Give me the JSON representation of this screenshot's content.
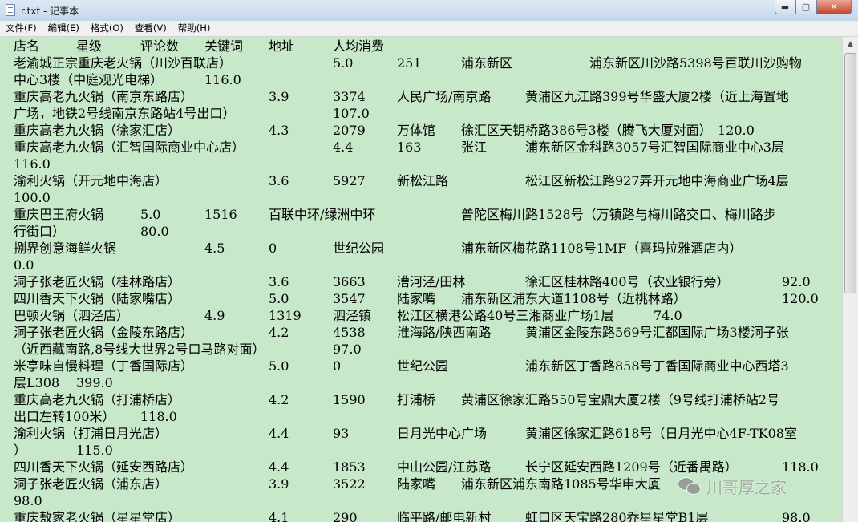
{
  "window": {
    "title": "r.txt - 记事本",
    "minimize": "▬",
    "maximize": "▢",
    "close": "✕"
  },
  "menu": [
    "文件(F)",
    "编辑(E)",
    "格式(O)",
    "查看(V)",
    "帮助(H)"
  ],
  "document": {
    "lines": [
      [
        "店名",
        "星级",
        "评论数",
        "关键词",
        "地址",
        "人均消费"
      ],
      [
        "老渝城正宗重庆老火锅（川沙百联店）",
        "5.0",
        "251",
        "浦东新区",
        "浦东新区川沙路5398号百联川沙购物"
      ],
      [
        "中心3楼（中庭观光电梯）",
        "116.0"
      ],
      [
        "重庆高老九火锅（南京东路店）",
        "3.9",
        "3374",
        "人民广场/南京路",
        "黄浦区九江路399号华盛大厦2楼（近上海置地"
      ],
      [
        "广场，地铁2号线南京东路站4号出口）",
        "107.0"
      ],
      [
        "重庆高老九火锅（徐家汇店）",
        "4.3",
        "2079",
        "万体馆",
        "徐汇区天钥桥路386号3楼（腾飞大厦对面）",
        "120.0"
      ],
      [
        "重庆高老九火锅（汇智国际商业中心店）",
        "4.4",
        "163",
        "张江",
        "浦东新区金科路3057号汇智国际商业中心3层"
      ],
      [
        "116.0"
      ],
      [
        "渝利火锅（开元地中海店）",
        "3.6",
        "5927",
        "新松江路",
        "松江区新松江路927弄开元地中海商业广场4层"
      ],
      [
        "100.0"
      ],
      [
        "重庆巴王府火锅",
        "5.0",
        "1516",
        "百联中环/绿洲中环",
        "普陀区梅川路1528号（万镇路与梅川路交口、梅川路步"
      ],
      [
        "行街口）",
        "80.0"
      ],
      [
        "捌界创意海鲜火锅",
        "4.5",
        "0",
        "世纪公园",
        "浦东新区梅花路1108号1MF（喜玛拉雅酒店内）"
      ],
      [
        "0.0"
      ],
      [
        "洞子张老匠火锅（桂林路店）",
        "3.6",
        "3663",
        "漕河泾/田林",
        "徐汇区桂林路400号（农业银行旁）",
        "92.0"
      ],
      [
        "四川香天下火锅（陆家嘴店）",
        "5.0",
        "3547",
        "陆家嘴",
        "浦东新区浦东大道1108号（近桃林路）",
        "120.0"
      ],
      [
        "巴顿火锅（泗泾店）",
        "4.9",
        "1319",
        "泗泾镇",
        "松江区横港公路40号三湘商业广场1层",
        "74.0"
      ],
      [
        "洞子张老匠火锅（金陵东路店）",
        "4.2",
        "4538",
        "淮海路/陕西南路",
        "黄浦区金陵东路569号汇都国际广场3楼洞子张"
      ],
      [
        "（近西藏南路,8号线大世界2号口马路对面）",
        "97.0"
      ],
      [
        "米亭味自慢料理（丁香国际店）",
        "5.0",
        "0",
        "世纪公园",
        "浦东新区丁香路858号丁香国际商业中心西塔3"
      ],
      [
        "层L308",
        "399.0"
      ],
      [
        "重庆高老九火锅（打浦桥店）",
        "4.2",
        "1590",
        "打浦桥",
        "黄浦区徐家汇路550号宝鼎大厦2楼（9号线打浦桥站2号"
      ],
      [
        "出口左转100米）",
        "118.0"
      ],
      [
        "渝利火锅（打浦日月光店）",
        "4.4",
        "93",
        "日月光中心广场",
        "黄浦区徐家汇路618号（日月光中心4F-TK08室"
      ],
      [
        "）",
        "115.0"
      ],
      [
        "四川香天下火锅（延安西路店）",
        "4.4",
        "1853",
        "中山公园/江苏路",
        "长宁区延安西路1209号（近番禺路）",
        "118.0"
      ],
      [
        "洞子张老匠火锅（浦东店）",
        "3.9",
        "3522",
        "陆家嘴",
        "浦东新区浦东南路1085号华申大厦"
      ],
      [
        "98.0"
      ],
      [
        "重庆敖家老火锅（星星堂店）",
        "4.1",
        "290",
        "临平路/邮电新村",
        "虹口区天宝路280乔星星堂B1层",
        "98.0"
      ]
    ]
  },
  "watermark": {
    "icon": "wechat-icon",
    "text": "川哥厚之家"
  },
  "colors": {
    "editor_bg": "#c7e8c9",
    "text": "#000000",
    "close_button": "#c4442c"
  }
}
